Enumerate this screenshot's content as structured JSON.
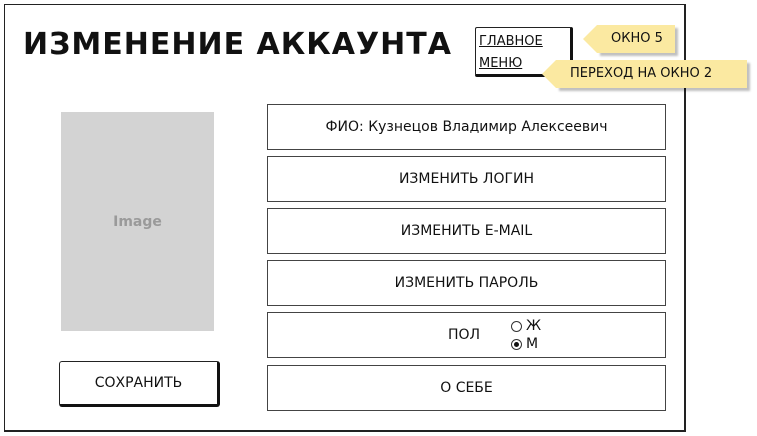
{
  "header": {
    "title": "ИЗМЕНЕНИЕ АККАУНТА",
    "menu_button": {
      "line1": "ГЛАВНОЕ",
      "line2": "МЕНЮ"
    }
  },
  "callouts": {
    "window": "ОКНО 5",
    "transition": "ПЕРЕХОД НА ОКНО 2"
  },
  "image_placeholder": "Image",
  "save_button": "СОХРАНИТЬ",
  "fields": {
    "full_name": "ФИО: Кузнецов Владимир Алексеевич",
    "change_login": "ИЗМЕНИТЬ ЛОГИН",
    "change_email": "ИЗМЕНИТЬ E-MAIL",
    "change_password": "ИЗМЕНИТЬ ПАРОЛЬ",
    "gender": {
      "label": "ПОЛ",
      "options": [
        {
          "label": "Ж",
          "selected": false
        },
        {
          "label": "М",
          "selected": true
        }
      ]
    },
    "about": "О СЕБЕ"
  },
  "colors": {
    "callout_bg": "#fbe9a1",
    "image_bg": "#d3d3d3"
  }
}
